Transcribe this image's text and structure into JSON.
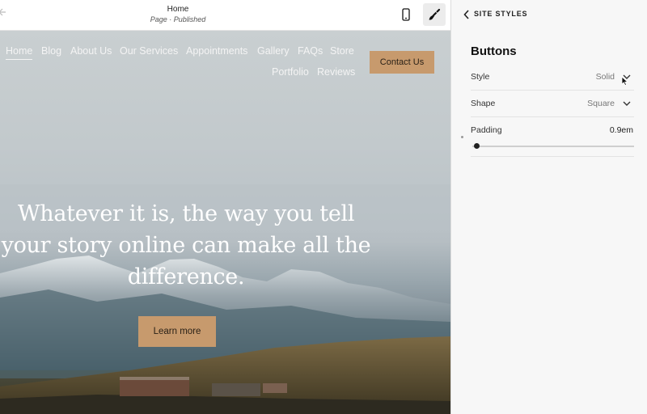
{
  "topbar": {
    "page_title": "Home",
    "page_status": "Page · Published",
    "back_icon": "arrow-left-icon",
    "mobile_icon": "mobile-phone-icon",
    "brush_icon": "paintbrush-icon"
  },
  "site": {
    "nav": {
      "items": [
        {
          "label": "Home",
          "active": true
        },
        {
          "label": "Blog"
        },
        {
          "label": "About Us"
        },
        {
          "label": "Our Services"
        },
        {
          "label": "Appointments"
        },
        {
          "label": "Gallery"
        },
        {
          "label": "FAQs"
        },
        {
          "label": "Store"
        },
        {
          "label": "Portfolio"
        },
        {
          "label": "Reviews"
        }
      ]
    },
    "contact_label": "Contact Us",
    "headline": "Whatever it is, the way you tell your story online can make all the difference.",
    "cta_label": "Learn more",
    "accent_color": "#c79a6d"
  },
  "panel": {
    "back_label": "SITE STYLES",
    "section_title": "Buttons",
    "style": {
      "label": "Style",
      "value": "Solid"
    },
    "shape": {
      "label": "Shape",
      "value": "Square"
    },
    "padding": {
      "label": "Padding",
      "value": "0.9em",
      "level": 0.02
    }
  }
}
